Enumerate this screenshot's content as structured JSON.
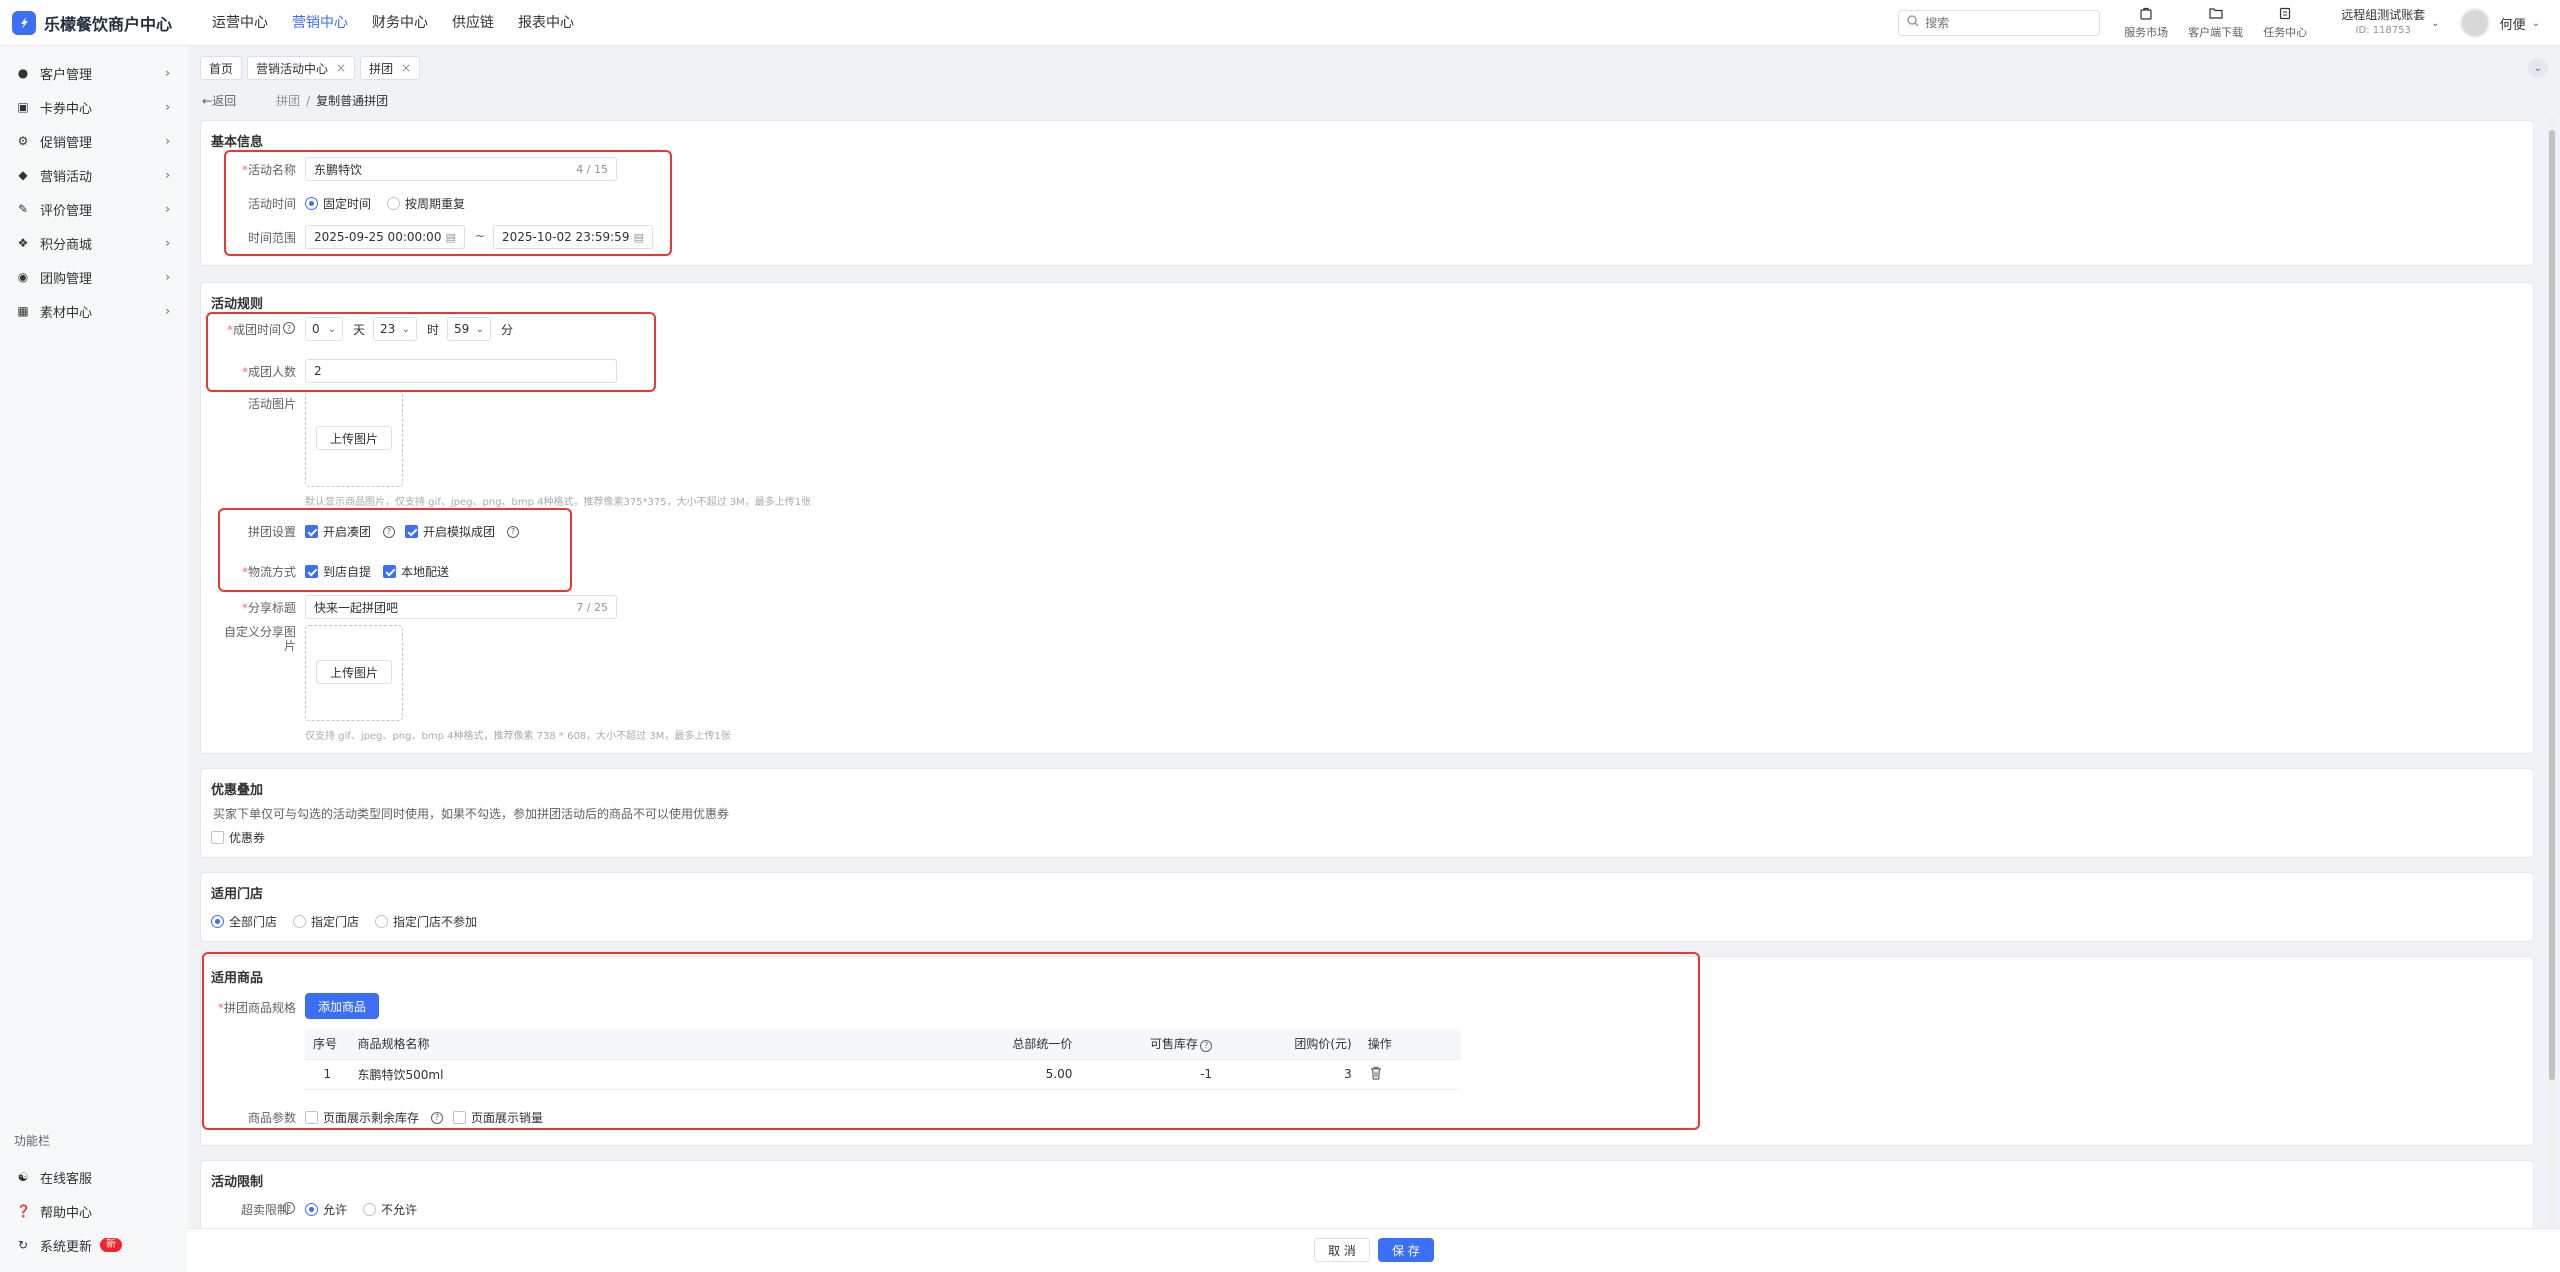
{
  "app": {
    "name": "乐檬餐饮商户中心",
    "logo_mark": "?"
  },
  "topnav": [
    {
      "label": "运营中心",
      "active": false
    },
    {
      "label": "营销中心",
      "active": true
    },
    {
      "label": "财务中心",
      "active": false
    },
    {
      "label": "供应链",
      "active": false
    },
    {
      "label": "报表中心",
      "active": false
    }
  ],
  "search": {
    "placeholder": "搜索"
  },
  "tools": [
    "服务市场",
    "客户端下载",
    "任务中心"
  ],
  "account": {
    "name": "远程组测试账套",
    "id": "ID: 118753",
    "user": "何便"
  },
  "sidebar": {
    "items": [
      "客户管理",
      "卡券中心",
      "促销管理",
      "营销活动",
      "评价管理",
      "积分商城",
      "团购管理",
      "素材中心"
    ],
    "section": "功能栏",
    "bottom": [
      "在线客服",
      "帮助中心",
      "系统更新"
    ],
    "new_badge": "新"
  },
  "tabs": [
    {
      "label": "首页",
      "closable": false
    },
    {
      "label": "营销活动中心",
      "closable": true
    },
    {
      "label": "拼团",
      "closable": true
    }
  ],
  "breadcrumb": {
    "back": "返回",
    "parent": "拼团",
    "sep": "/",
    "current": "复制普通拼团"
  },
  "basic": {
    "title": "基本信息",
    "name_label": "活动名称",
    "name_value": "东鹏特饮",
    "name_count": "4 / 15",
    "time_label": "活动时间",
    "time_opts": [
      "固定时间",
      "按周期重复"
    ],
    "range_label": "时间范围",
    "start": "2025-09-25 00:00:00",
    "range_sep": "~",
    "end": "2025-10-02 23:59:59"
  },
  "rules": {
    "title": "活动规则",
    "group_time_label": "成团时间",
    "day_val": "0",
    "day_unit": "天",
    "hour_val": "23",
    "hour_unit": "时",
    "min_val": "59",
    "min_unit": "分",
    "people_label": "成团人数",
    "people_value": "2",
    "image_label": "活动图片",
    "upload_label": "上传图片",
    "image_hint": "默认显示商品图片，仅支持 gif、jpeg、png、bmp 4种格式，推荐像素375*375，大小不超过 3M，最多上传1张",
    "setting_label": "拼团设置",
    "setting_opts": [
      "开启凑团",
      "开启模拟成团"
    ],
    "logistics_label": "物流方式",
    "logistics_opts": [
      "到店自提",
      "本地配送"
    ],
    "share_title_label": "分享标题",
    "share_title_value": "快来一起拼团吧",
    "share_title_count": "7 / 25",
    "share_img_label_1": "自定义分享图",
    "share_img_label_2": "片",
    "share_hint": "仅支持 gif、jpeg、png、bmp 4种格式，推荐像素 738 * 608，大小不超过 3M，最多上传1张"
  },
  "stack": {
    "title": "优惠叠加",
    "desc": "买家下单仅可与勾选的活动类型同时使用，如果不勾选，参加拼团活动后的商品不可以使用优惠券",
    "coupon": "优惠券"
  },
  "stores": {
    "title": "适用门店",
    "opts": [
      "全部门店",
      "指定门店",
      "指定门店不参加"
    ]
  },
  "goods": {
    "title": "适用商品",
    "spec_label": "拼团商品规格",
    "add_btn": "添加商品",
    "columns": [
      "序号",
      "商品规格名称",
      "总部统一价",
      "可售库存",
      "团购价(元)",
      "操作"
    ],
    "rows": [
      [
        "1",
        "东鹏特饮500ml",
        "5.00",
        "-1",
        "3"
      ]
    ],
    "param_label": "商品参数",
    "param_opts": [
      "页面展示剩余库存",
      "页面展示销量"
    ]
  },
  "limit": {
    "title": "活动限制",
    "over_label": "超卖限制",
    "opts": [
      "允许",
      "不允许"
    ]
  },
  "footer": {
    "cancel": "取 消",
    "save": "保 存"
  },
  "colors": {
    "accent": "#3b6ff5",
    "highlight": "#e53935",
    "required": "#f56c6c"
  }
}
